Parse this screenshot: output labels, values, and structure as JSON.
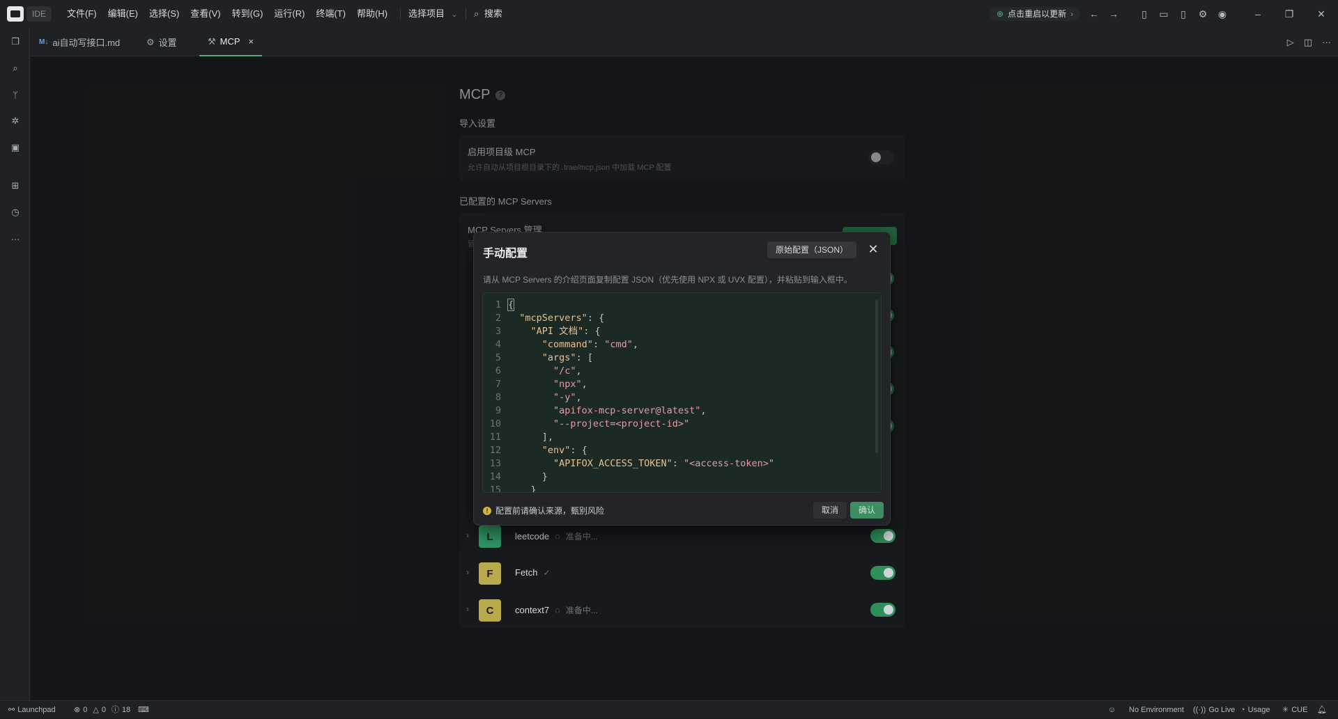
{
  "titlebar": {
    "ide_label": "IDE",
    "menu": [
      "文件(F)",
      "编辑(E)",
      "选择(S)",
      "查看(V)",
      "转到(G)",
      "运行(R)",
      "终端(T)",
      "帮助(H)"
    ],
    "project_select": "选择项目",
    "search": "搜索",
    "update_label": "点击重启以更新"
  },
  "tabs": [
    {
      "label": "ai自动写接口.md",
      "icon": "markdown-icon"
    },
    {
      "label": "设置",
      "icon": "gear-icon"
    },
    {
      "label": "MCP",
      "icon": "wrench-icon"
    }
  ],
  "page": {
    "title": "MCP",
    "import_section": "导入设置",
    "project_mcp_title": "启用项目级 MCP",
    "project_mcp_desc": "允许自动从项目根目录下的 .trae/mcp.json 中加载 MCP 配置",
    "configured_section": "已配置的 MCP Servers",
    "servers_mgmt": "MCP Servers 管理",
    "servers_mgmt_sub": "管"
  },
  "servers": [
    {
      "letter": "L",
      "name": "leetcode",
      "status": "准备中...",
      "color": "#2f9a66",
      "enabled": true
    },
    {
      "letter": "F",
      "name": "Fetch",
      "status": "✓",
      "color": "#b9a94a",
      "enabled": true
    },
    {
      "letter": "C",
      "name": "context7",
      "status": "准备中...",
      "color": "#b9a94a",
      "enabled": true
    }
  ],
  "modal": {
    "title": "手动配置",
    "json_button": "原始配置（JSON）",
    "description": "请从 MCP Servers 的介绍页面复制配置 JSON（优先使用 NPX 或 UVX 配置），并粘贴到输入框中。",
    "warning": "配置前请确认来源，甄别风险",
    "cancel": "取消",
    "confirm": "确认",
    "code_lines": [
      "{",
      "  \"mcpServers\": {",
      "    \"API 文档\": {",
      "      \"command\": \"cmd\",",
      "      \"args\": [",
      "        \"/c\",",
      "        \"npx\",",
      "        \"-y\",",
      "        \"apifox-mcp-server@latest\",",
      "        \"--project=<project-id>\"",
      "      ],",
      "      \"env\": {",
      "        \"APIFOX_ACCESS_TOKEN\": \"<access-token>\"",
      "      }",
      "    }"
    ]
  },
  "statusbar": {
    "launchpad": "Launchpad",
    "errors": "0",
    "warnings": "0",
    "infos": "18",
    "environment": "No Environment",
    "go_live": "Go Live",
    "usage": "Usage",
    "cue": "CUE"
  },
  "colors": {
    "accent": "#3e8e63",
    "toggle_on": "#2f8f5a"
  }
}
